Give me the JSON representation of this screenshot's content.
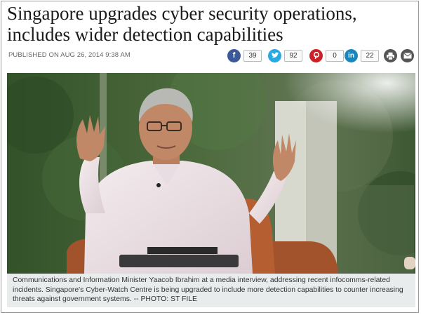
{
  "article": {
    "headline_line1": "Singapore upgrades cyber security operations,",
    "headline_line2": "includes wider detection capabilities",
    "published": "PUBLISHED ON AUG 26, 2014 9:38 AM"
  },
  "share": {
    "facebook": {
      "icon": "facebook-icon",
      "count": "39",
      "color": "#3b5998"
    },
    "twitter": {
      "icon": "twitter-icon",
      "count": "92",
      "color": "#29a9e1"
    },
    "pinterest": {
      "icon": "pinterest-icon",
      "count": "0",
      "color": "#cb2027"
    },
    "linkedin": {
      "icon": "linkedin-icon",
      "count": "22",
      "color": "#1b86bc"
    },
    "print": {
      "icon": "print-icon"
    },
    "email": {
      "icon": "email-icon"
    }
  },
  "photo": {
    "caption": "Communications and Information Minister Yaacob Ibrahim at a media interview, addressing recent infocomms-related incidents. Singapore's Cyber-Watch Centre is being upgraded to include more detection capabilities to counter increasing threats against government systems. -- PHOTO: ST FILE"
  }
}
